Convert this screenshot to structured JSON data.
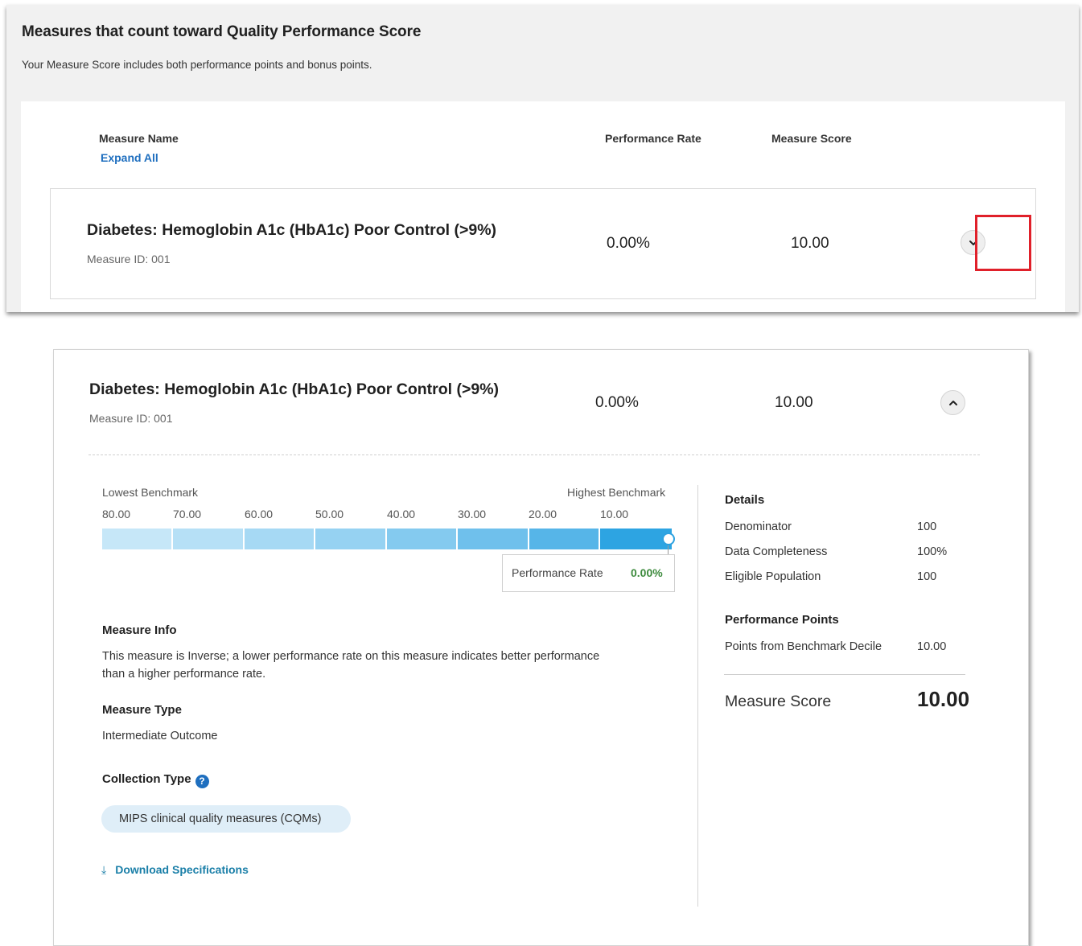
{
  "colors": {
    "link_blue": "#1f6fbf",
    "highlight_red": "#e0202a",
    "perf_green": "#3c8a3c",
    "bar_light": "#bfe3f6",
    "bar_dark": "#2da1e0",
    "pill_bg": "#dfeef8"
  },
  "collapsed": {
    "title": "Measures that count toward Quality Performance Score",
    "subtitle": "Your Measure Score includes both performance points and bonus points.",
    "columns": {
      "measure_name": "Measure Name",
      "expand_all": "Expand All",
      "performance_rate": "Performance Rate",
      "measure_score": "Measure Score"
    },
    "measure": {
      "name": "Diabetes: Hemoglobin A1c (HbA1c) Poor Control (>9%)",
      "id_label": "Measure ID: 001",
      "performance_rate": "0.00%",
      "score": "10.00",
      "toggle_icon": "chevron-down-icon"
    }
  },
  "expanded": {
    "measure": {
      "name": "Diabetes: Hemoglobin A1c (HbA1c) Poor Control (>9%)",
      "id_label": "Measure ID: 001",
      "performance_rate": "0.00%",
      "score": "10.00",
      "toggle_icon": "chevron-up-icon"
    },
    "benchmark": {
      "lowest_label": "Lowest Benchmark",
      "highest_label": "Highest Benchmark",
      "ticks": [
        "80.00",
        "70.00",
        "60.00",
        "50.00",
        "40.00",
        "30.00",
        "20.00",
        "10.00"
      ],
      "perf_rate_label": "Performance Rate",
      "perf_rate_value": "0.00%"
    },
    "measure_info": {
      "heading": "Measure Info",
      "text_line1": "This measure is Inverse; a lower performance rate on this measure indicates better performance",
      "text_line2": "than a higher performance rate.",
      "type_heading": "Measure Type",
      "type_value": "Intermediate Outcome",
      "collection_heading": "Collection Type",
      "collection_value": "MIPS clinical quality measures (CQMs)",
      "download_label": "Download Specifications"
    },
    "details": {
      "heading": "Details",
      "rows": [
        {
          "label": "Denominator",
          "value": "100"
        },
        {
          "label": "Data Completeness",
          "value": "100%"
        },
        {
          "label": "Eligible Population",
          "value": "100"
        }
      ],
      "points_heading": "Performance Points",
      "points_label": "Points from Benchmark Decile",
      "points_value": "10.00",
      "measure_score_label": "Measure Score",
      "measure_score_value": "10.00"
    }
  }
}
